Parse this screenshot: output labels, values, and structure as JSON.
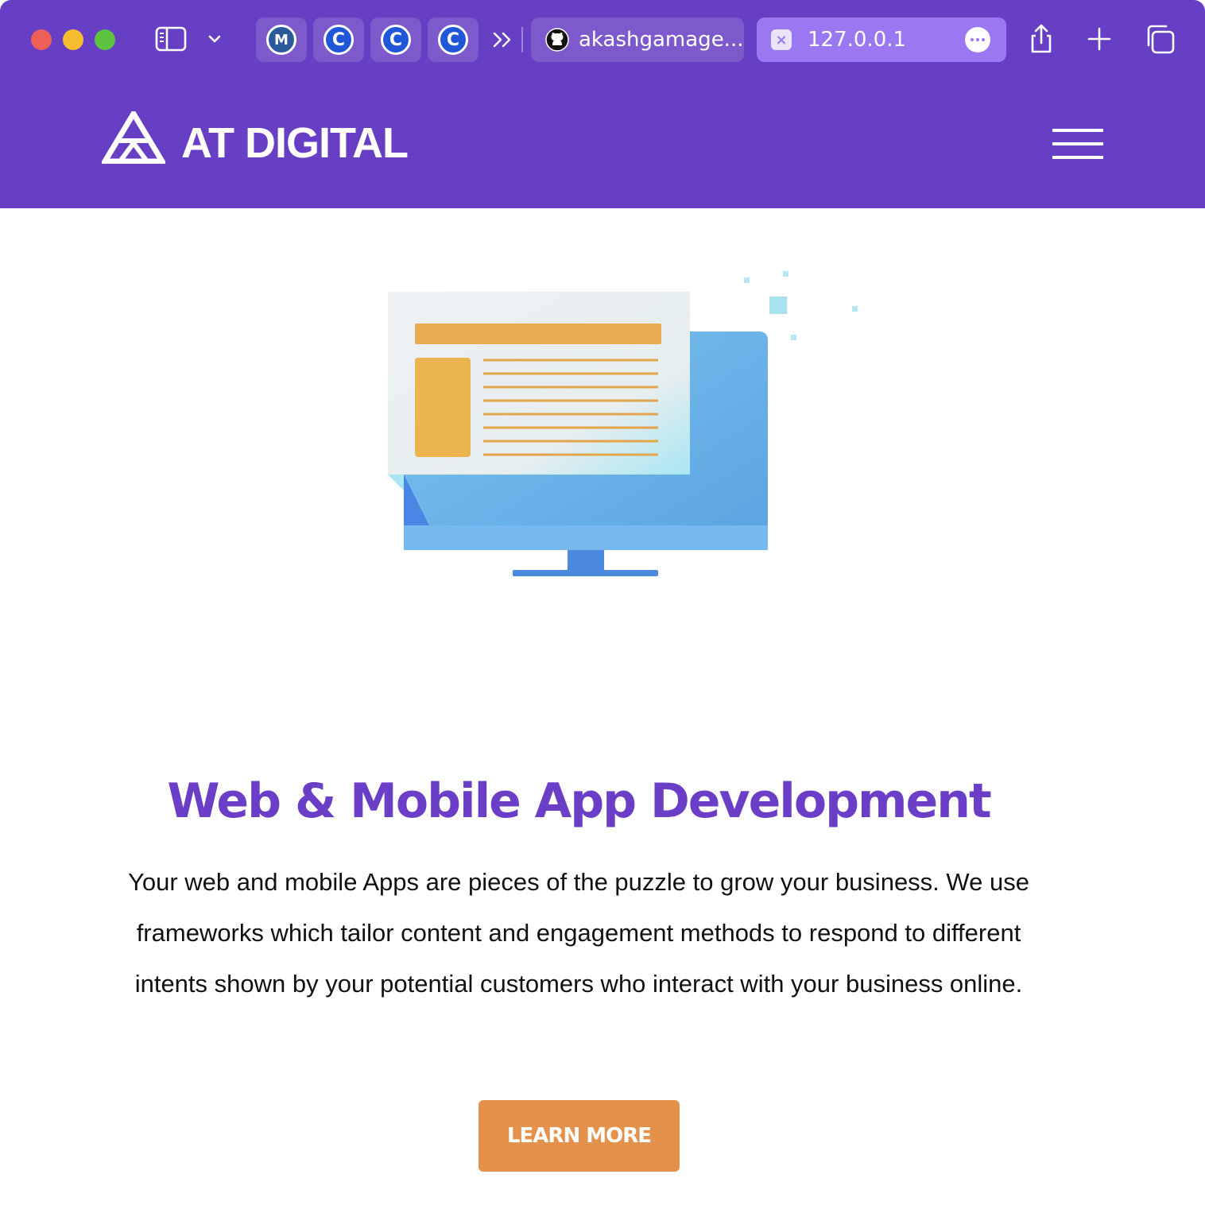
{
  "browser": {
    "pinned_tabs": [
      {
        "icon": "m-logo-icon",
        "glyph": "M"
      },
      {
        "icon": "c-logo-icon",
        "glyph": "C"
      },
      {
        "icon": "c-logo-icon",
        "glyph": "C"
      },
      {
        "icon": "c-logo-icon",
        "glyph": "C"
      }
    ],
    "tabs": [
      {
        "label": "akashgamage...",
        "icon": "github-icon"
      },
      {
        "label": "127.0.0.1",
        "icon": "close-icon",
        "active": true
      }
    ],
    "colors": {
      "chrome": "#673fc4",
      "active_tab": "#9a78f2"
    }
  },
  "site": {
    "brand": "AT DIGITAL",
    "menu_icon": "hamburger-menu-icon",
    "headline": "Web & Mobile App Development",
    "body": "Your web and mobile Apps are pieces of the puzzle to grow your business. We use frameworks which tailor content and engagement methods to respond to different intents shown by your potential customers who interact with your business online.",
    "cta_label": "LEARN MORE",
    "illustration": "desktop-monitor-illustration",
    "colors": {
      "header": "#673fc4",
      "headline": "#6a3ec7",
      "cta": "#e3914b"
    }
  }
}
